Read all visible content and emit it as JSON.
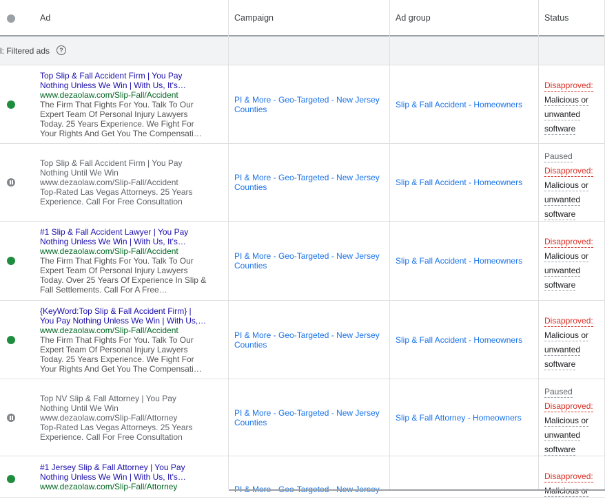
{
  "header": {
    "ad": "Ad",
    "campaign": "Campaign",
    "ad_group": "Ad group",
    "status": "Status"
  },
  "total": {
    "label": "l: Filtered ads",
    "help": "?"
  },
  "rows": [
    {
      "state": "enabled",
      "headline": [
        "Top Slip & Fall Accident Firm | You Pay",
        "Nothing Unless We Win | With Us, It's…"
      ],
      "url": "www.dezaolaw.com/Slip-Fall/Accident",
      "desc": [
        "The Firm That Fights For You. Talk To Our",
        "Expert Team Of Personal Injury Lawyers",
        "Today. 25 Years Experience. We Fight For",
        "Your Rights And Get You The Compensati…"
      ],
      "campaign": [
        "PI & More - Geo-Targeted - New Jersey",
        "Counties"
      ],
      "ad_group": "Slip & Fall Accident - Homeowners",
      "status": {
        "paused": "",
        "disapproved": "Disapproved:",
        "reason": [
          "Malicious or",
          "unwanted",
          "software"
        ]
      }
    },
    {
      "state": "paused",
      "headline": [
        "Top Slip & Fall Accident Firm | You Pay",
        "Nothing Until We Win"
      ],
      "url": "www.dezaolaw.com/Slip-Fall/Accident",
      "desc": [
        "Top-Rated Las Vegas Attorneys. 25 Years",
        "Experience. Call For Free Consultation"
      ],
      "campaign": [
        "PI & More - Geo-Targeted - New Jersey",
        "Counties"
      ],
      "ad_group": "Slip & Fall Accident - Homeowners",
      "status": {
        "paused": "Paused",
        "disapproved": "Disapproved:",
        "reason": [
          "Malicious or",
          "unwanted",
          "software"
        ]
      }
    },
    {
      "state": "enabled",
      "headline": [
        "#1 Slip & Fall Accident Lawyer | You Pay",
        "Nothing Unless We Win | With Us, It's…"
      ],
      "url": "www.dezaolaw.com/Slip-Fall/Accident",
      "desc": [
        "The Firm That Fights For You. Talk To Our",
        "Expert Team Of Personal Injury Lawyers",
        "Today. Over 25 Years Of Experience In Slip &",
        "Fall Settlements. Call For A Free…"
      ],
      "campaign": [
        "PI & More - Geo-Targeted - New Jersey",
        "Counties"
      ],
      "ad_group": "Slip & Fall Accident - Homeowners",
      "status": {
        "paused": "",
        "disapproved": "Disapproved:",
        "reason": [
          "Malicious or",
          "unwanted",
          "software"
        ]
      }
    },
    {
      "state": "enabled",
      "headline": [
        "{KeyWord:Top Slip & Fall Accident Firm} |",
        "You Pay Nothing Unless We Win | With Us,…"
      ],
      "url": "www.dezaolaw.com/Slip-Fall/Accident",
      "desc": [
        "The Firm That Fights For You. Talk To Our",
        "Expert Team Of Personal Injury Lawyers",
        "Today. 25 Years Experience. We Fight For",
        "Your Rights And Get You The Compensati…"
      ],
      "campaign": [
        "PI & More - Geo-Targeted - New Jersey",
        "Counties"
      ],
      "ad_group": "Slip & Fall Accident - Homeowners",
      "status": {
        "paused": "",
        "disapproved": "Disapproved:",
        "reason": [
          "Malicious or",
          "unwanted",
          "software"
        ]
      }
    },
    {
      "state": "paused",
      "headline": [
        "Top NV Slip & Fall Attorney | You Pay",
        "Nothing Until We Win"
      ],
      "url": "www.dezaolaw.com/Slip-Fall/Attorney",
      "desc": [
        "Top-Rated Las Vegas Attorneys. 25 Years",
        "Experience. Call For Free Consultation"
      ],
      "campaign": [
        "PI & More - Geo-Targeted - New Jersey",
        "Counties"
      ],
      "ad_group": "Slip & Fall Attorney - Homeowners",
      "status": {
        "paused": "Paused",
        "disapproved": "Disapproved:",
        "reason": [
          "Malicious or",
          "unwanted",
          "software"
        ]
      }
    },
    {
      "state": "enabled",
      "headline": [
        "#1 Jersey Slip & Fall Attorney | You Pay",
        "Nothing Unless We Win | With Us, It's…"
      ],
      "url": "www.dezaolaw.com/Slip-Fall/Attorney",
      "desc": [],
      "campaign": [
        "PI & More - Geo-Targeted - New Jersey"
      ],
      "ad_group": "",
      "status": {
        "paused": "",
        "disapproved": "Disapproved:",
        "reason": [
          "Malicious or"
        ]
      }
    }
  ]
}
